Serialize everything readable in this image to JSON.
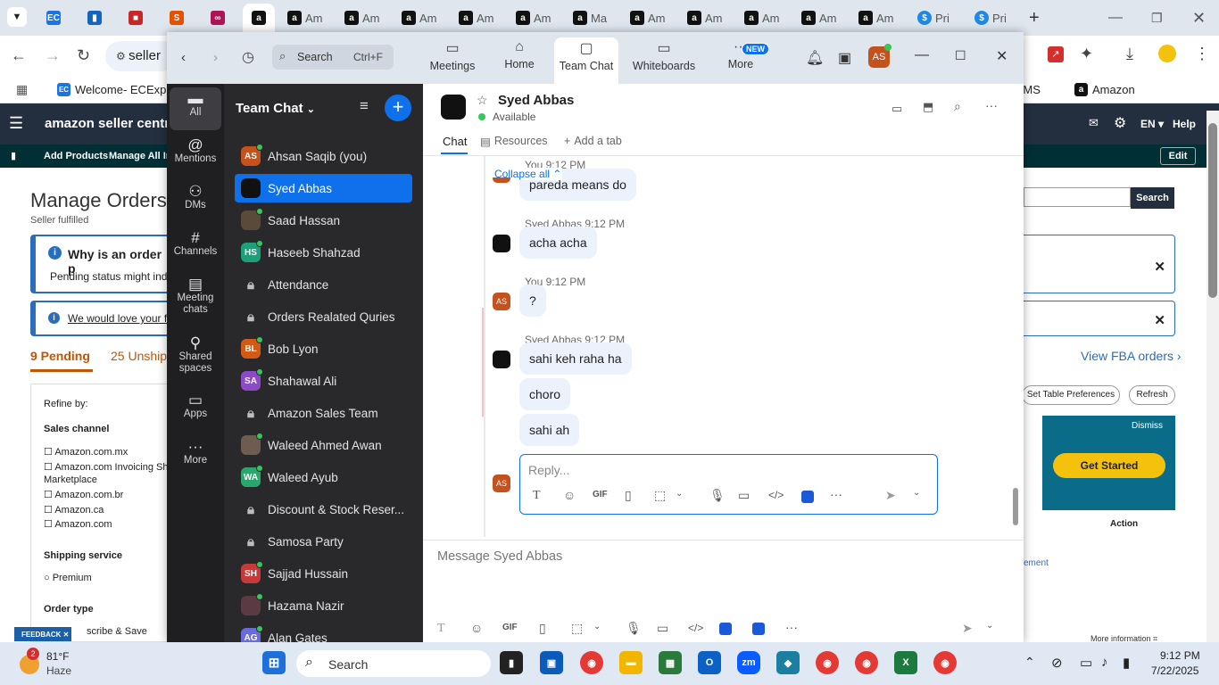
{
  "browser": {
    "tabs": [
      "Am",
      "Am",
      "Am",
      "Am",
      "Am",
      "Ma",
      "Am",
      "Am",
      "Am",
      "Am",
      "Pri",
      "Pri"
    ],
    "address": "seller",
    "bookmarks": [
      {
        "label": "Welcome- ECExpre"
      },
      {
        "label": "CMS"
      },
      {
        "label": "Amazon"
      }
    ]
  },
  "amazon": {
    "logo": "amazon seller central",
    "nav": [
      "Add Products",
      "Manage All Inv"
    ],
    "lang": "EN",
    "help": "Help",
    "edit": "Edit",
    "title": "Manage Orders",
    "subtitle": "Seller fulfilled",
    "alert1_title": "Why is an order p",
    "alert1_body": "Pending status might indica",
    "alert2": "We would love your fee",
    "tab_pending": "9 Pending",
    "tab_unshipped": "25 Unship",
    "search_btn": "Search",
    "fba": "View FBA orders",
    "table_prefs": "Set Table Preferences",
    "refresh": "Refresh",
    "refine": "Refine by:",
    "sales_channel": "Sales channel",
    "channels": [
      "Amazon.com.mx",
      "Amazon.com Invoicing Sha",
      "Marketplace",
      "Amazon.com.br",
      "Amazon.ca",
      "Amazon.com"
    ],
    "shipping_service": "Shipping service",
    "premium": "Premium",
    "order_type": "Order type",
    "subscribe": "scribe & Save",
    "dismiss": "Dismiss",
    "get_started": "Get Started",
    "action": "Action",
    "feedback": "FEEDBACK",
    "more_info": "More information",
    "ement": "ement"
  },
  "zoom": {
    "search": {
      "label": "Search",
      "shortcut": "Ctrl+F"
    },
    "nav": [
      {
        "label": "Meetings"
      },
      {
        "label": "Home"
      },
      {
        "label": "Team Chat"
      },
      {
        "label": "Whiteboards"
      },
      {
        "label": "More",
        "badge": "NEW"
      }
    ],
    "avatar": "AS",
    "rail": [
      {
        "label": "All"
      },
      {
        "label": "Mentions"
      },
      {
        "label": "DMs"
      },
      {
        "label": "Channels"
      },
      {
        "label": "Meeting chats"
      },
      {
        "label": "Shared spaces"
      },
      {
        "label": "Apps"
      },
      {
        "label": "More"
      }
    ],
    "list_title": "Team Chat",
    "contacts": [
      {
        "name": "Ahsan Saqib (you)",
        "ini": "AS",
        "color": "#c5511d"
      },
      {
        "name": "Syed Abbas",
        "ini": "",
        "color": "#111111"
      },
      {
        "name": "Saad Hassan",
        "ini": "",
        "color": "#5a4a3a"
      },
      {
        "name": "Haseeb Shahzad",
        "ini": "HS",
        "color": "#1f9e7a"
      },
      {
        "name": "Attendance",
        "ini": "",
        "color": ""
      },
      {
        "name": "Orders Realated Quries",
        "ini": "",
        "color": ""
      },
      {
        "name": "Bob Lyon",
        "ini": "BL",
        "color": "#d35a14"
      },
      {
        "name": "Shahawal Ali",
        "ini": "SA",
        "color": "#8a4bc4"
      },
      {
        "name": "Amazon Sales Team",
        "ini": "",
        "color": ""
      },
      {
        "name": "Waleed Ahmed Awan",
        "ini": "",
        "color": "#6d5c4f"
      },
      {
        "name": "Waleed Ayub",
        "ini": "WA",
        "color": "#2ba66d"
      },
      {
        "name": "Discount & Stock Reser...",
        "ini": "",
        "color": ""
      },
      {
        "name": "Samosa Party",
        "ini": "",
        "color": ""
      },
      {
        "name": "Sajjad Hussain",
        "ini": "SH",
        "color": "#c73a3a"
      },
      {
        "name": "Hazama Nazir",
        "ini": "",
        "color": "#5b3a44"
      },
      {
        "name": "Alan Gates",
        "ini": "AG",
        "color": "#6b6bd6"
      }
    ],
    "chat": {
      "name": "Syed Abbas",
      "status": "Available",
      "tabs": [
        "Chat",
        "Resources",
        "Add a tab"
      ],
      "collapse": "Collapse all",
      "first_msg": "pareda means do",
      "first_time": "You 9:12 PM",
      "messages": [
        {
          "sender": "Syed Abbas",
          "time": "9:12 PM",
          "avatar": "",
          "texts": [
            "acha acha"
          ]
        },
        {
          "sender": "You",
          "time": "9:12 PM",
          "avatar": "AS",
          "texts": [
            "?"
          ]
        },
        {
          "sender": "Syed Abbas",
          "time": "9:12 PM",
          "avatar": "",
          "texts": [
            "sahi keh raha ha",
            "choro",
            "sahi ah"
          ]
        }
      ],
      "reply_placeholder": "Reply...",
      "compose_placeholder": "Message Syed Abbas"
    }
  },
  "taskbar": {
    "weather_temp": "81°F",
    "weather_desc": "Haze",
    "search": "Search",
    "time": "9:12 PM",
    "date": "7/22/2025",
    "alert_count": "2"
  }
}
